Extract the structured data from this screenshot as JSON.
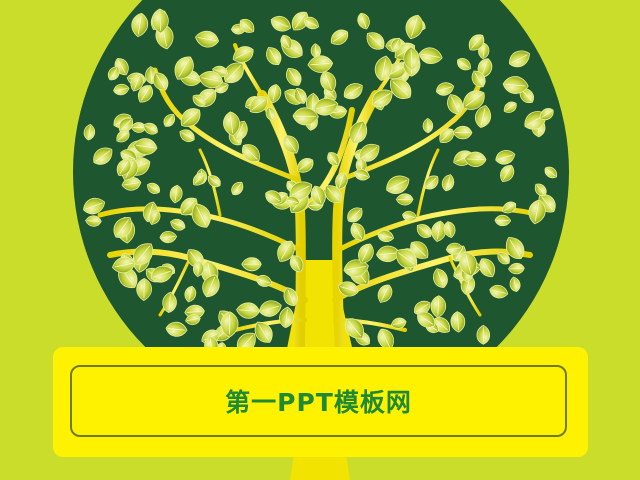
{
  "slide": {
    "title": "第一PPT模板网",
    "illustration": "tree-with-leaves",
    "colors": {
      "background": "#c9dd2a",
      "circle": "#1e5630",
      "trunk": "#f2e300",
      "leaf": "#b7cc2c",
      "banner": "#fff200",
      "banner_border": "#6e7a12",
      "title": "#1f8a33"
    }
  }
}
